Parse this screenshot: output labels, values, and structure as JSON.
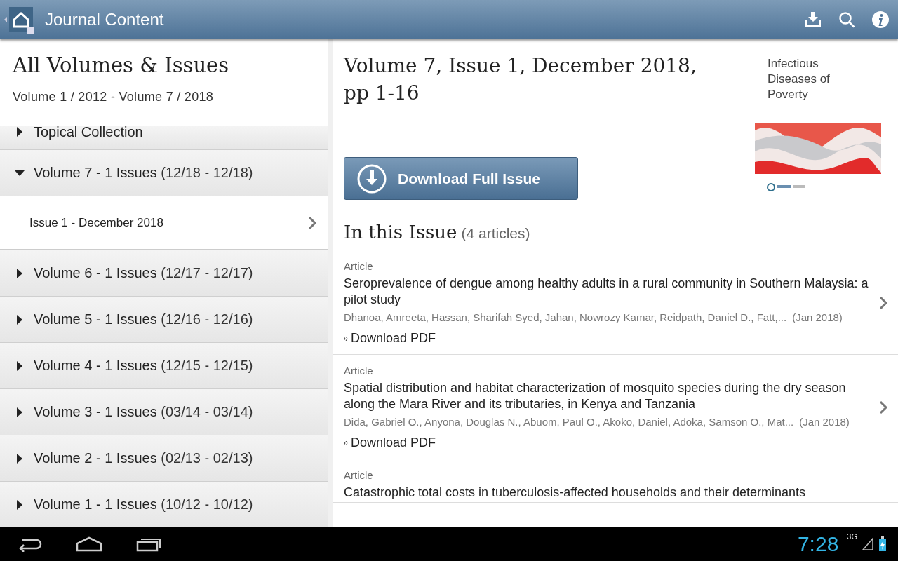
{
  "app_bar": {
    "title": "Journal Content"
  },
  "sidebar": {
    "title": "All Volumes & Issues",
    "range": "Volume 1 / 2012 - Volume 7 / 2018",
    "items": [
      {
        "label": "Topical Collection",
        "expanded": false
      },
      {
        "label": "Volume 7 - 1 Issues",
        "range": "(12/18 - 12/18)",
        "expanded": true,
        "children": [
          {
            "label": "Issue 1 - December 2018"
          }
        ]
      },
      {
        "label": "Volume 6 - 1 Issues",
        "range": "(12/17 - 12/17)",
        "expanded": false
      },
      {
        "label": "Volume 5 - 1 Issues",
        "range": "(12/16 - 12/16)",
        "expanded": false
      },
      {
        "label": "Volume 4 - 1 Issues",
        "range": "(12/15 - 12/15)",
        "expanded": false
      },
      {
        "label": "Volume 3 - 1 Issues",
        "range": "(03/14 - 03/14)",
        "expanded": false
      },
      {
        "label": "Volume 2 - 1 Issues",
        "range": "(02/13 - 02/13)",
        "expanded": false
      },
      {
        "label": "Volume 1 - 1 Issues",
        "range": "(10/12 - 10/12)",
        "expanded": false
      }
    ]
  },
  "issue": {
    "title": "Volume 7, Issue 1, December 2018, pp 1-16",
    "cover_title": "Infectious Diseases of Poverty",
    "download_button": "Download Full Issue",
    "section_title": "In this Issue",
    "count": "(4 articles)",
    "articles": [
      {
        "type": "Article",
        "title": "Seroprevalence of dengue among healthy adults in a rural community in Southern Malaysia: a pilot study",
        "authors": "Dhanoa, Amreeta, Hassan, Sharifah Syed, Jahan, Nowrozy Kamar, Reidpath, Daniel D., Fatt,...",
        "date": "(Jan 2018)",
        "link": "Download PDF"
      },
      {
        "type": "Article",
        "title": "Spatial distribution and habitat characterization of mosquito species during the dry season along the Mara River and its tributaries, in Kenya and Tanzania",
        "authors": "Dida, Gabriel O., Anyona, Douglas N., Abuom, Paul O., Akoko, Daniel, Adoka, Samson O., Mat...",
        "date": "(Jan 2018)",
        "link": "Download PDF"
      },
      {
        "type": "Article",
        "title": "Catastrophic total costs in tuberculosis-affected households and their determinants"
      }
    ]
  },
  "status_bar": {
    "time": "7:28",
    "network": "3G"
  }
}
